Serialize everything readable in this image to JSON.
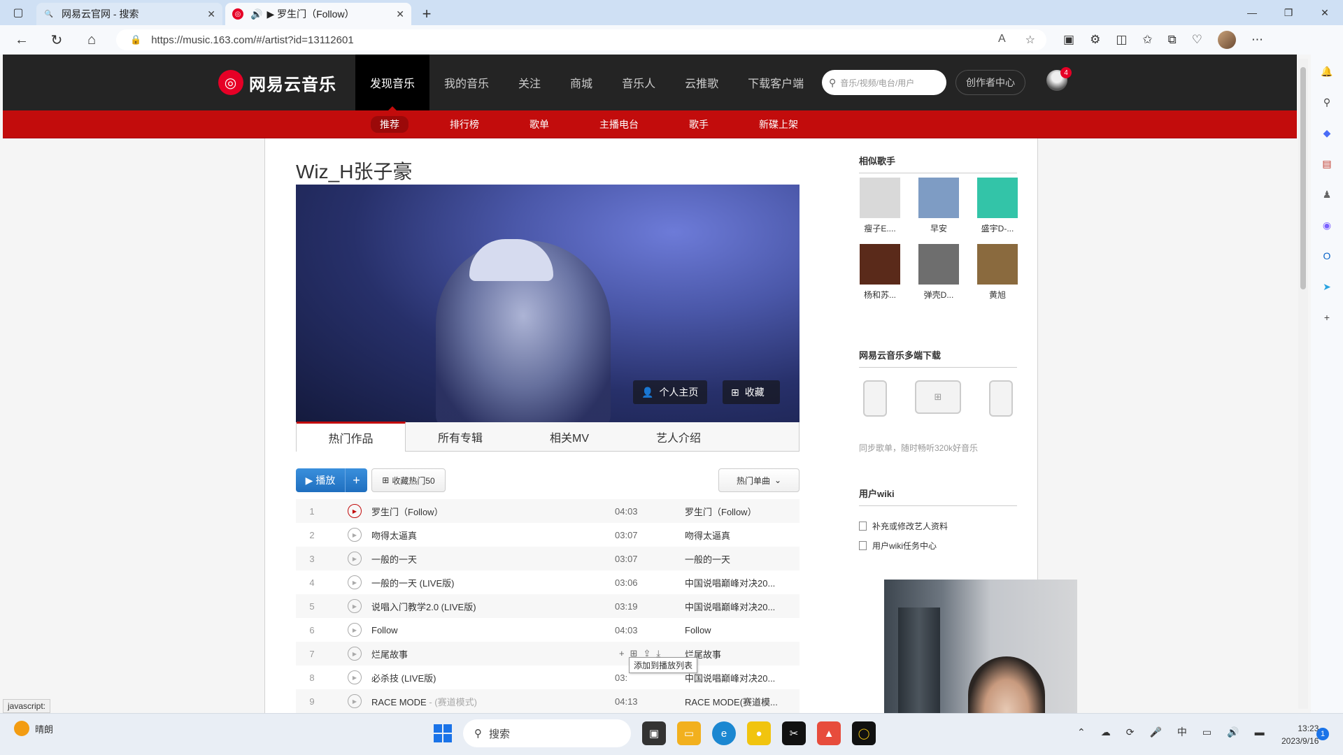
{
  "browser": {
    "tabs": [
      {
        "title": "网易云官网 - 搜索",
        "active": false
      },
      {
        "title": "▶ 罗生门（Follow）",
        "active": true
      }
    ],
    "url": "https://music.163.com/#/artist?id=13112601",
    "status_url": "javascript:"
  },
  "site": {
    "logo_text": "网易云音乐",
    "main_nav": [
      "发现音乐",
      "我的音乐",
      "关注",
      "商城",
      "音乐人",
      "云推歌",
      "下载客户端"
    ],
    "search_placeholder": "音乐/视频/电台/用户",
    "creator_label": "创作者中心",
    "notification_count": "4",
    "sub_nav": [
      "推荐",
      "排行榜",
      "歌单",
      "主播电台",
      "歌手",
      "新碟上架"
    ]
  },
  "artist": {
    "name": "Wiz_H张子豪",
    "home_button": "个人主页",
    "fav_button": "收藏",
    "tabs": [
      "热门作品",
      "所有专辑",
      "相关MV",
      "艺人介绍"
    ],
    "play_label": "播放",
    "collect_label": "收藏热门50",
    "sort_label": "热门单曲",
    "tooltip": "添加到播放列表"
  },
  "songs": [
    {
      "num": "1",
      "name": "罗生门（Follow）",
      "alias": "",
      "duration": "04:03",
      "album": "罗生门（Follow）"
    },
    {
      "num": "2",
      "name": "吻得太逼真",
      "alias": "",
      "duration": "03:07",
      "album": "吻得太逼真"
    },
    {
      "num": "3",
      "name": "一般的一天",
      "alias": "",
      "duration": "03:07",
      "album": "一般的一天"
    },
    {
      "num": "4",
      "name": "一般的一天 (LIVE版)",
      "alias": "",
      "duration": "03:06",
      "album": "中国说唱巅峰对决20..."
    },
    {
      "num": "5",
      "name": "说唱入门教学2.0 (LIVE版)",
      "alias": "",
      "duration": "03:19",
      "album": "中国说唱巅峰对决20..."
    },
    {
      "num": "6",
      "name": "Follow",
      "alias": "",
      "duration": "04:03",
      "album": "Follow"
    },
    {
      "num": "7",
      "name": "烂尾故事",
      "alias": "",
      "duration": "",
      "album": "烂尾故事"
    },
    {
      "num": "8",
      "name": "必杀技 (LIVE版)",
      "alias": "",
      "duration": "03:",
      "album": "中国说唱巅峰对决20..."
    },
    {
      "num": "9",
      "name": "RACE MODE",
      "alias": " - (赛道模式)",
      "duration": "04:13",
      "album": "RACE MODE(赛道模..."
    }
  ],
  "similar": {
    "title": "相似歌手",
    "artists": [
      "瘦子E....",
      "早安",
      "盛宇D-...",
      "杨和苏...",
      "弹壳D...",
      "黄旭"
    ],
    "colors": [
      "#d9d9d9",
      "#7e9cc4",
      "#33c4a8",
      "#5a2a1a",
      "#6e6e6e",
      "#8a6a3e"
    ]
  },
  "download": {
    "title": "网易云音乐多端下载",
    "text": "同步歌单，随时畅听320k好音乐"
  },
  "wiki": {
    "title": "用户wiki",
    "items": [
      "补充或修改艺人资料",
      "用户wiki任务中心"
    ]
  },
  "taskbar": {
    "weather": "晴朗",
    "search": "搜索",
    "time": "13:23",
    "date": "2023/9/16",
    "ime": "中",
    "notif": "1"
  }
}
